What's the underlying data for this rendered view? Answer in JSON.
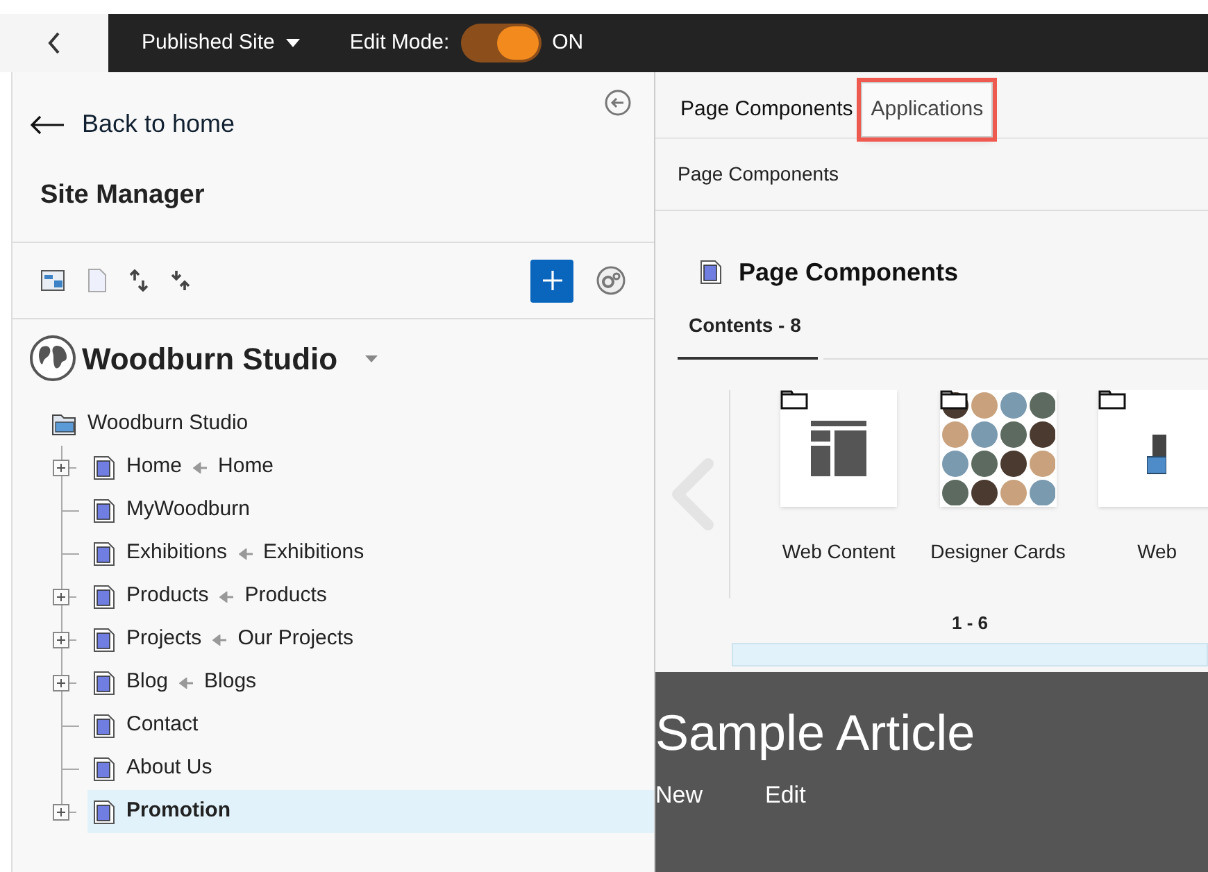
{
  "top_bar": {
    "site_menu": "Published Site",
    "edit_mode_label": "Edit Mode:",
    "edit_mode": {
      "on": true,
      "label": "ON"
    }
  },
  "site_manager": {
    "back_link": "Back to home",
    "title": "Site Manager",
    "site_name": "Woodburn Studio",
    "tree": [
      {
        "label": "Woodburn Studio",
        "kind": "site",
        "selected": false,
        "children": [
          {
            "label": "Home",
            "alias": "Home",
            "kind": "page",
            "expandable": true,
            "selected": false
          },
          {
            "label": "MyWoodburn",
            "kind": "page",
            "expandable": false,
            "selected": false
          },
          {
            "label": "Exhibitions",
            "alias": "Exhibitions",
            "kind": "page",
            "expandable": false,
            "selected": false
          },
          {
            "label": "Products",
            "alias": "Products",
            "kind": "page",
            "expandable": true,
            "selected": false
          },
          {
            "label": "Projects",
            "alias": "Our Projects",
            "kind": "page",
            "expandable": true,
            "selected": false
          },
          {
            "label": "Blog",
            "alias": "Blogs",
            "kind": "page",
            "expandable": true,
            "selected": false
          },
          {
            "label": "Contact",
            "kind": "page",
            "expandable": false,
            "selected": false
          },
          {
            "label": "About Us",
            "kind": "page",
            "expandable": false,
            "selected": false
          },
          {
            "label": "Promotion",
            "kind": "page",
            "expandable": true,
            "selected": true
          }
        ]
      }
    ]
  },
  "palette": {
    "tabs": [
      {
        "label": "Page Components",
        "selected": true,
        "highlighted": false
      },
      {
        "label": "Applications",
        "selected": false,
        "highlighted": true
      }
    ],
    "breadcrumb": "Page Components",
    "heading": "Page Components",
    "contents_tab": "Contents - 8",
    "items": [
      {
        "label": "Web Content",
        "kind": "layout"
      },
      {
        "label": "Designer Cards",
        "kind": "people"
      },
      {
        "label": "Web",
        "kind": "partial"
      }
    ],
    "pager": "1 - 6"
  },
  "article": {
    "title": "Sample Article",
    "actions": [
      "New",
      "Edit"
    ]
  }
}
